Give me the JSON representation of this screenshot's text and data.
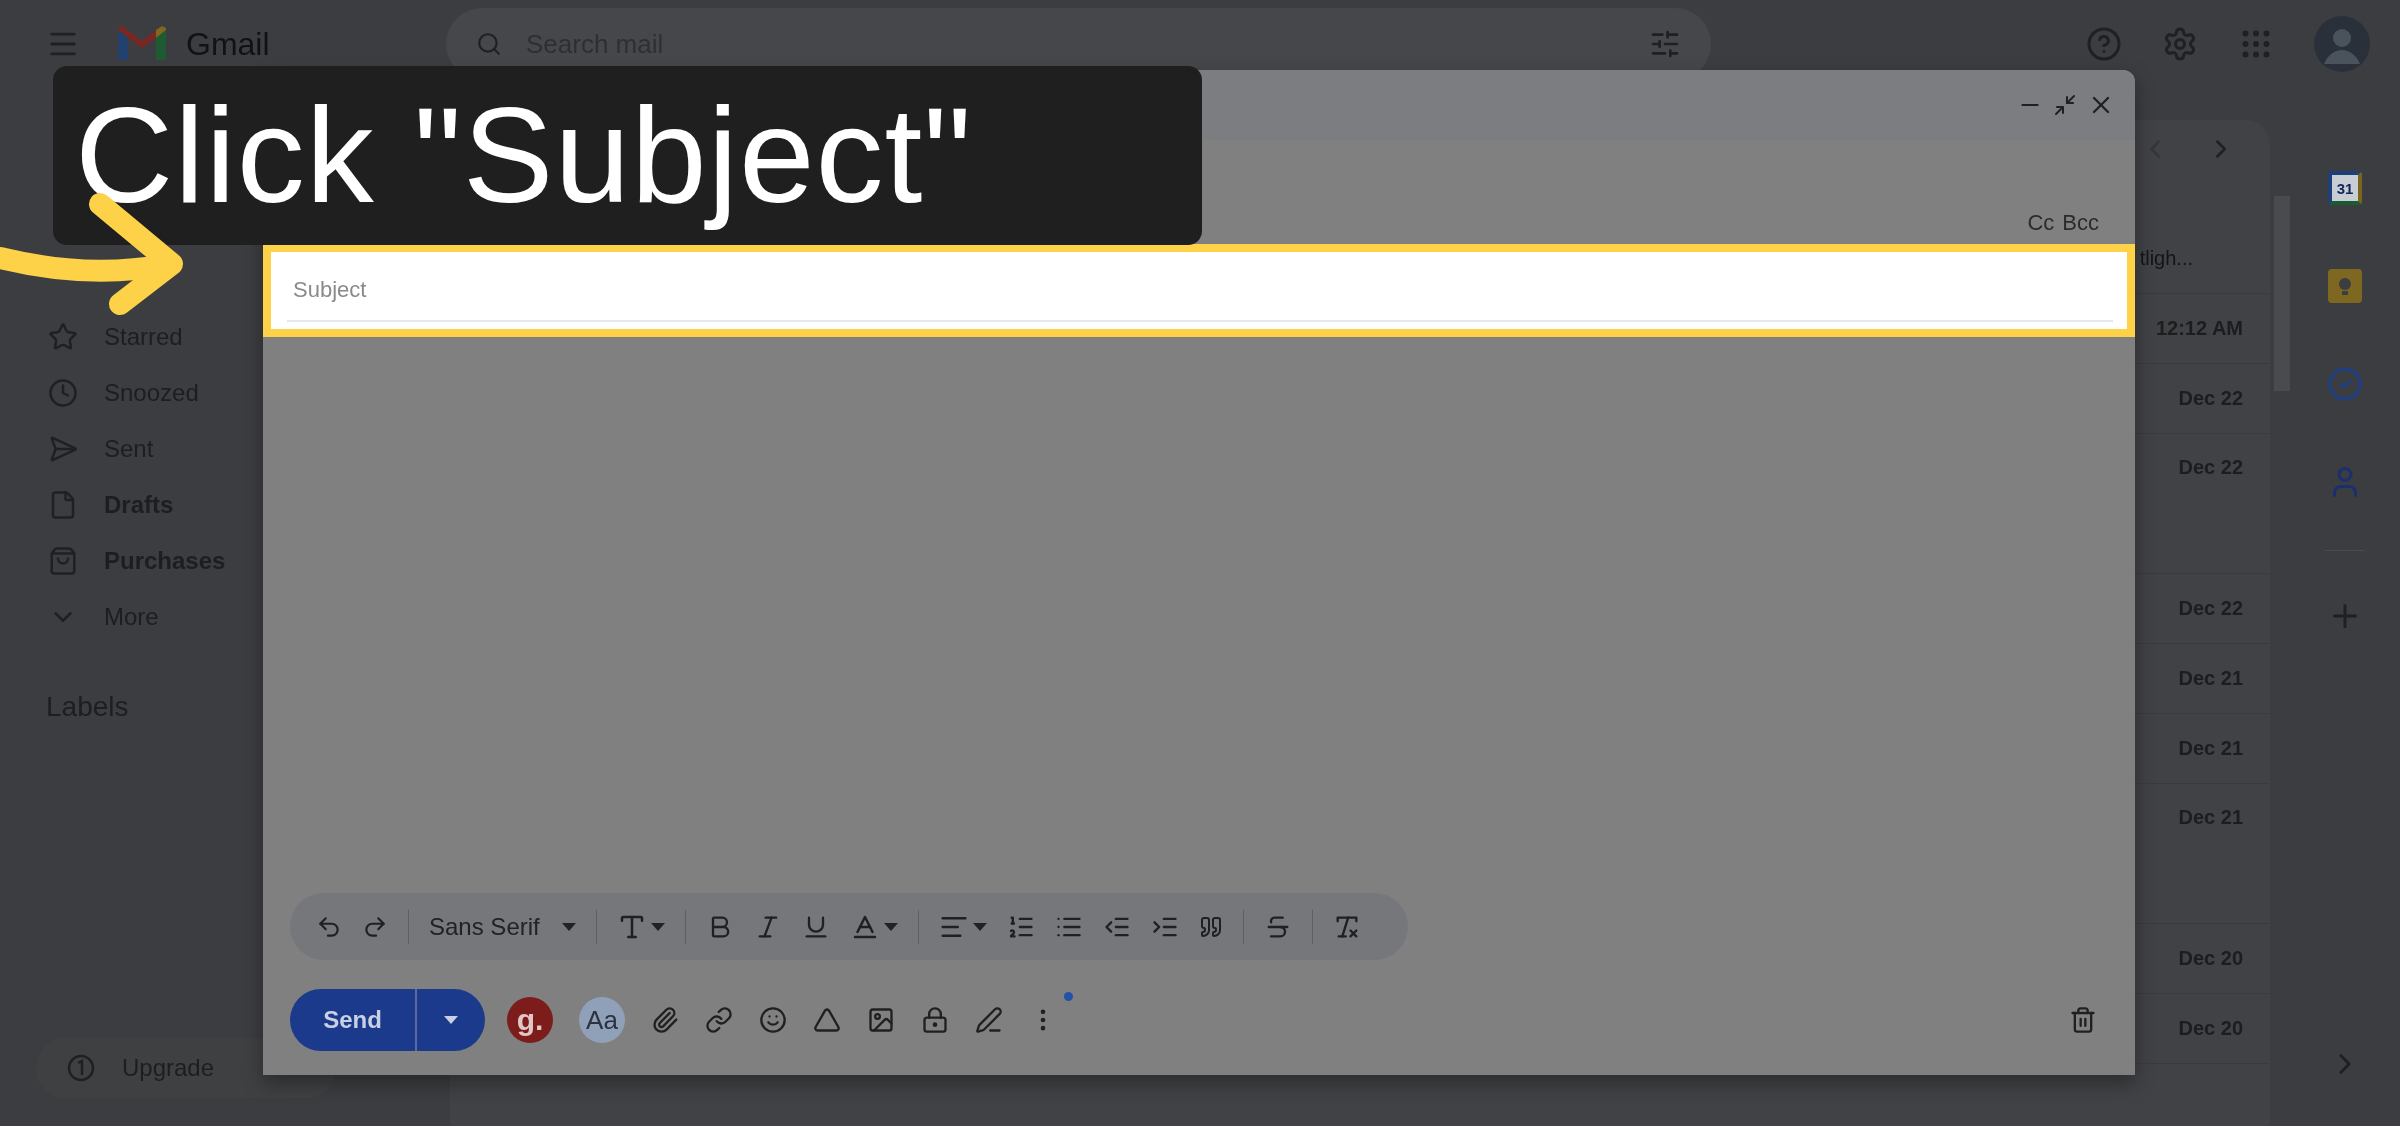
{
  "top_bar": {
    "app_name": "Gmail",
    "search": {
      "placeholder": "Search mail"
    }
  },
  "sidebar": {
    "items": [
      {
        "label": "Starred",
        "unread": false
      },
      {
        "label": "Snoozed",
        "unread": false
      },
      {
        "label": "Sent",
        "unread": false
      },
      {
        "label": "Drafts",
        "unread": true
      },
      {
        "label": "Purchases",
        "unread": true
      },
      {
        "label": "More",
        "unread": false
      }
    ],
    "labels_heading": "Labels",
    "upgrade": "Upgrade"
  },
  "mail_list": {
    "rows": [
      {
        "kind": "snippet",
        "text": "tligh...",
        "tall": false
      },
      {
        "kind": "date",
        "text": "12:12 AM",
        "tall": false
      },
      {
        "kind": "date",
        "text": "Dec 22",
        "tall": false
      },
      {
        "kind": "date",
        "text": "Dec 22",
        "tall": true
      },
      {
        "kind": "date",
        "text": "Dec 22",
        "tall": false
      },
      {
        "kind": "date",
        "text": "Dec 21",
        "tall": false
      },
      {
        "kind": "date",
        "text": "Dec 21",
        "tall": false
      },
      {
        "kind": "date",
        "text": "Dec 21",
        "tall": true
      },
      {
        "kind": "date",
        "text": "Dec 20",
        "tall": false
      },
      {
        "kind": "date",
        "text": "Dec 20",
        "tall": false
      }
    ]
  },
  "side_panel": {
    "calendar_day": "31"
  },
  "compose": {
    "cc": "Cc",
    "bcc": "Bcc",
    "subject": {
      "placeholder": "Subject"
    },
    "font": "Sans Serif",
    "send": "Send",
    "extensions": [
      "g.",
      "Aa"
    ]
  },
  "tutorial": {
    "caption": "Click \"Subject\""
  }
}
